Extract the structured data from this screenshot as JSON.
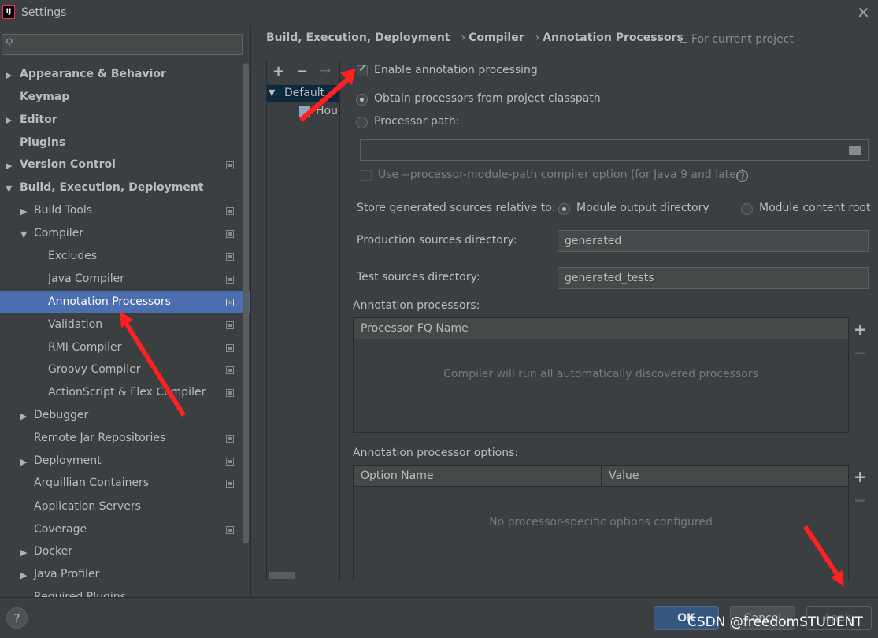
{
  "window": {
    "title": "Settings",
    "app_icon_text": "IJ"
  },
  "search": {
    "placeholder": ""
  },
  "sidebar": {
    "items": [
      {
        "label": "Appearance & Behavior"
      },
      {
        "label": "Keymap"
      },
      {
        "label": "Editor"
      },
      {
        "label": "Plugins"
      },
      {
        "label": "Version Control"
      },
      {
        "label": "Build, Execution, Deployment"
      },
      {
        "label": "Build Tools"
      },
      {
        "label": "Compiler"
      },
      {
        "label": "Excludes"
      },
      {
        "label": "Java Compiler"
      },
      {
        "label": "Annotation Processors"
      },
      {
        "label": "Validation"
      },
      {
        "label": "RMI Compiler"
      },
      {
        "label": "Groovy Compiler"
      },
      {
        "label": "ActionScript & Flex Compiler"
      },
      {
        "label": "Debugger"
      },
      {
        "label": "Remote Jar Repositories"
      },
      {
        "label": "Deployment"
      },
      {
        "label": "Arquillian Containers"
      },
      {
        "label": "Application Servers"
      },
      {
        "label": "Coverage"
      },
      {
        "label": "Docker"
      },
      {
        "label": "Java Profiler"
      },
      {
        "label": "Required Plugins"
      }
    ],
    "selected": "Annotation Processors"
  },
  "breadcrumb": {
    "items": [
      "Build, Execution, Deployment",
      "Compiler",
      "Annotation Processors"
    ],
    "separator": "›",
    "scope": "For current project"
  },
  "profiles": {
    "toolbar": {
      "add": "+",
      "remove": "−",
      "move": "→"
    },
    "default_label": "Default",
    "module_label": "Hou"
  },
  "settings": {
    "enable_label": "Enable annotation processing",
    "enable_checked": true,
    "obtain_label": "Obtain processors from project classpath",
    "processor_path_label": "Processor path:",
    "processor_path_value": "",
    "module_path_label": "Use --processor-module-path compiler option (for Java 9 and later)",
    "help_glyph": "?",
    "store_label": "Store generated sources relative to:",
    "module_output_label": "Module output directory",
    "module_content_label": "Module content root",
    "production_label": "Production sources directory:",
    "production_value": "generated",
    "test_label": "Test sources directory:",
    "test_value": "generated_tests"
  },
  "processors_table": {
    "title": "Annotation processors:",
    "column": "Processor FQ Name",
    "empty": "Compiler will run all automatically discovered processors",
    "add": "+",
    "remove": "−"
  },
  "options_table": {
    "title": "Annotation processor options:",
    "columns": [
      "Option Name",
      "Value"
    ],
    "empty": "No processor-specific options configured",
    "add": "+",
    "remove": "−"
  },
  "footer": {
    "help": "?",
    "ok": "OK",
    "cancel": "Cancel",
    "apply": "Apply"
  },
  "watermark": "CSDN @freedomSTUDENT",
  "colors": {
    "background": "#3c3f41",
    "selection": "#4b6eaf",
    "ok_button": "#365880",
    "annotation_arrow": "#ff2020"
  }
}
